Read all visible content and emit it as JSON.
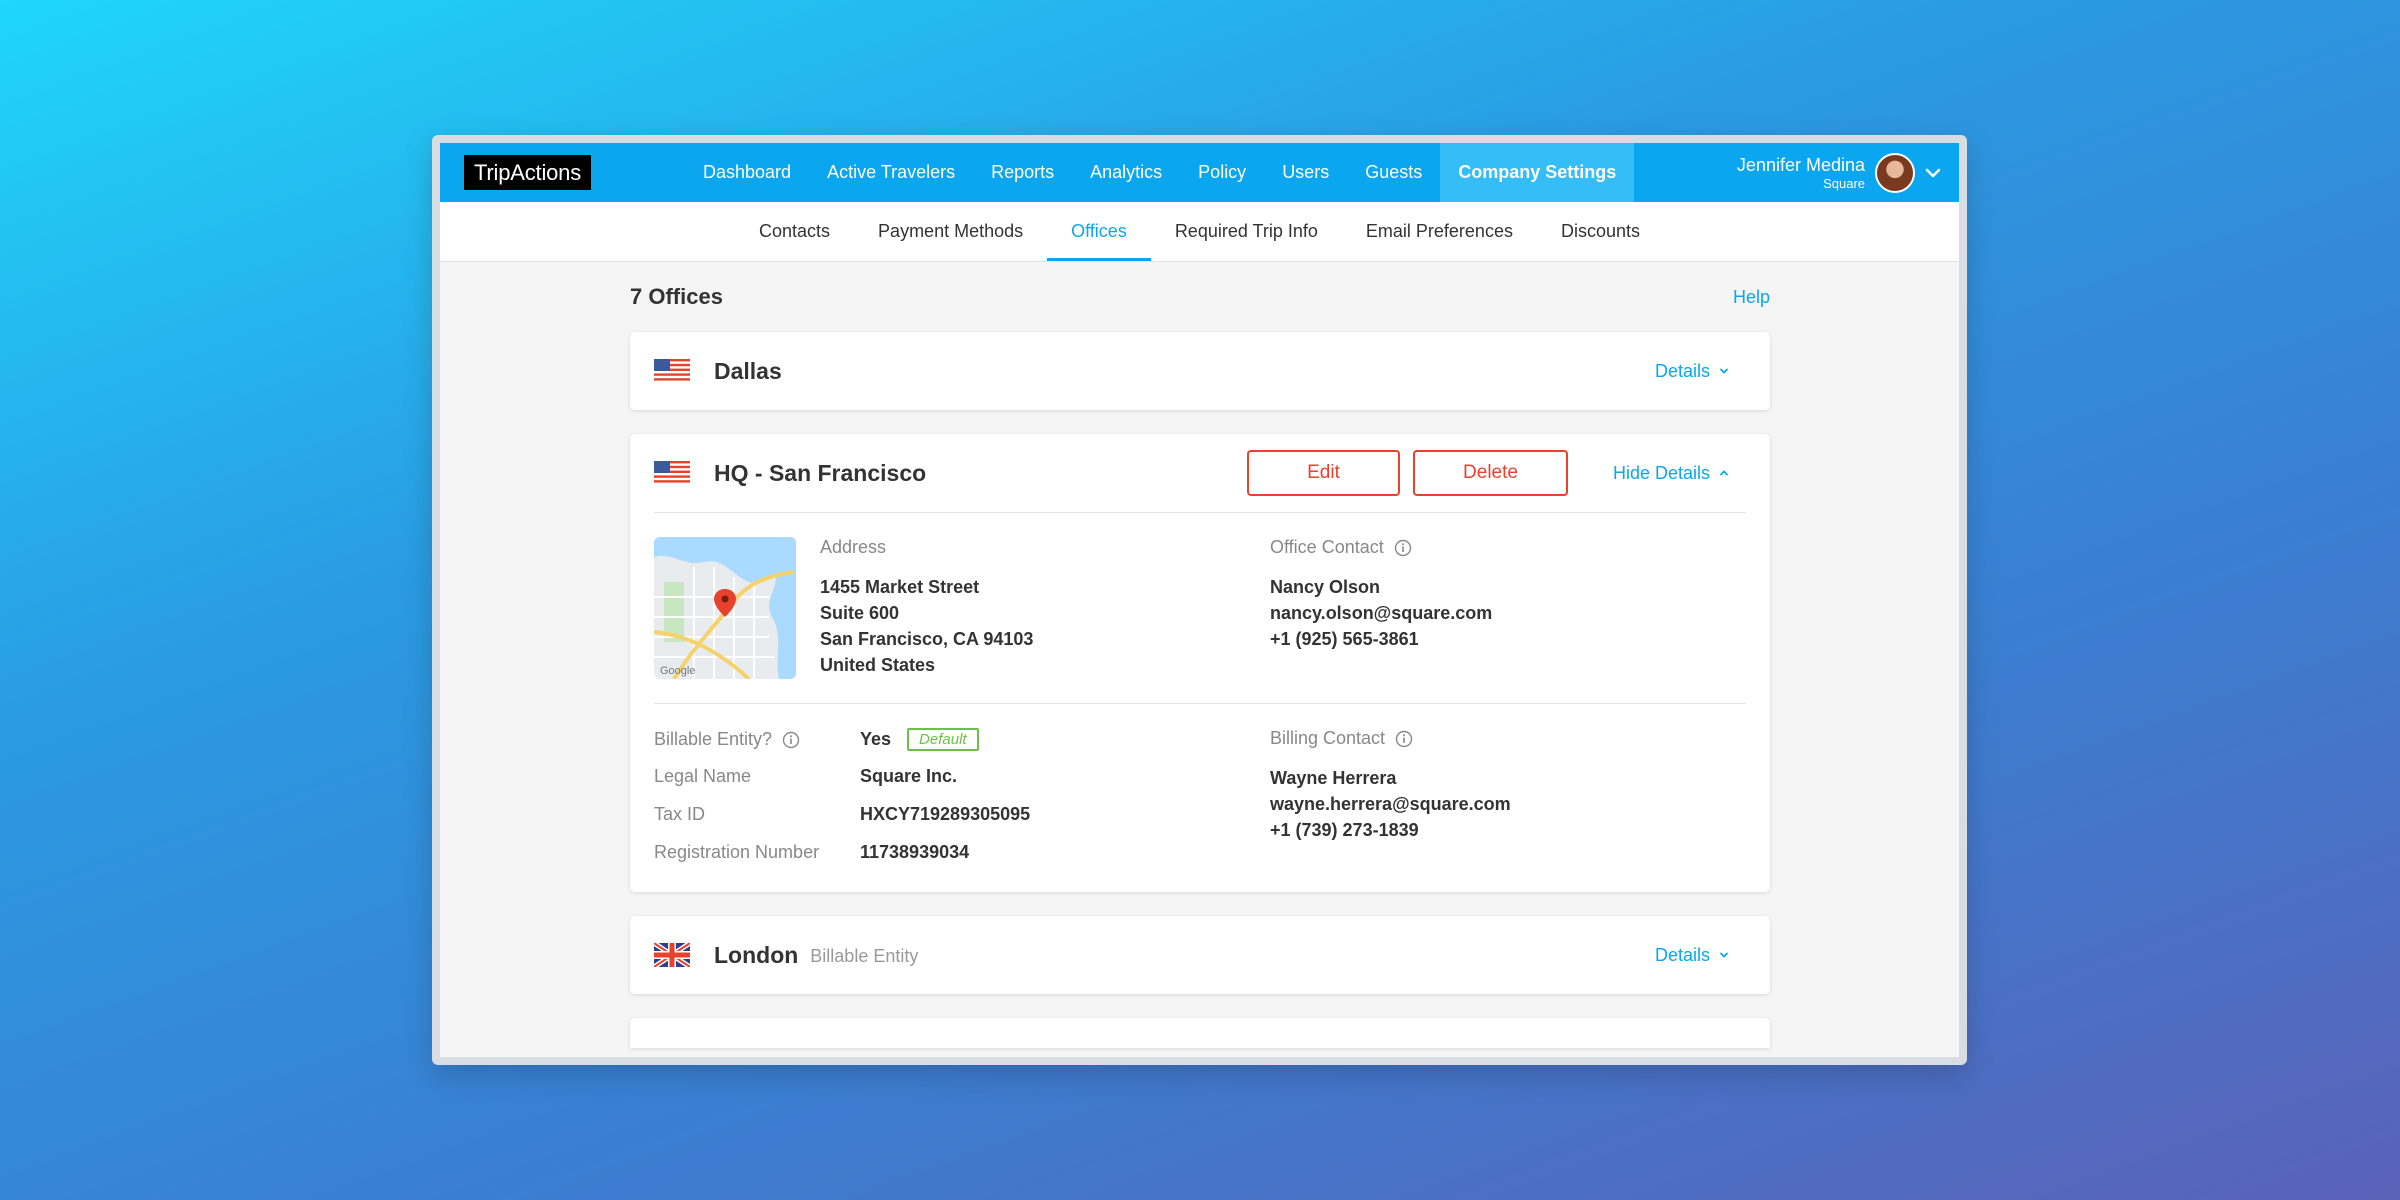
{
  "topnav": {
    "logo": "TripActions",
    "items": [
      {
        "label": "Dashboard"
      },
      {
        "label": "Active Travelers"
      },
      {
        "label": "Reports"
      },
      {
        "label": "Analytics"
      },
      {
        "label": "Policy"
      },
      {
        "label": "Users"
      },
      {
        "label": "Guests"
      },
      {
        "label": "Company Settings",
        "active": true
      }
    ],
    "user": {
      "name": "Jennifer Medina",
      "org": "Square"
    }
  },
  "subnav": {
    "items": [
      {
        "label": "Contacts"
      },
      {
        "label": "Payment Methods"
      },
      {
        "label": "Offices",
        "active": true
      },
      {
        "label": "Required Trip Info"
      },
      {
        "label": "Email Preferences"
      },
      {
        "label": "Discounts"
      }
    ]
  },
  "page": {
    "title": "7 Offices",
    "help": "Help"
  },
  "offices": [
    {
      "name": "Dallas",
      "flag": "us-flag-icon",
      "details_label": "Details"
    },
    {
      "name": "HQ - San Francisco",
      "flag": "us-flag-icon",
      "edit_label": "Edit",
      "delete_label": "Delete",
      "hide_details_label": "Hide Details",
      "address_label": "Address",
      "address": [
        "1455 Market Street",
        "Suite 600",
        "San Francisco, CA 94103",
        "United States"
      ],
      "office_contact_label": "Office Contact",
      "office_contact": [
        "Nancy Olson",
        "nancy.olson@square.com",
        "+1 (925) 565-3861"
      ],
      "billable_label": "Billable Entity?",
      "billable_value": "Yes",
      "default_badge": "Default",
      "legal_name_label": "Legal Name",
      "legal_name": "Square Inc.",
      "tax_id_label": "Tax ID",
      "tax_id": "HXCY719289305095",
      "registration_label": "Registration Number",
      "registration": "11738939034",
      "billing_contact_label": "Billing Contact",
      "billing_contact": [
        "Wayne Herrera",
        "wayne.herrera@square.com",
        "+1 (739) 273-1839"
      ],
      "map_watermark": "Google"
    },
    {
      "name": "London",
      "tag": "Billable Entity",
      "flag": "uk-flag-icon",
      "details_label": "Details"
    }
  ],
  "colors": {
    "brand": "#0aa6ef",
    "danger": "#e8412d",
    "success": "#6cc04a"
  }
}
